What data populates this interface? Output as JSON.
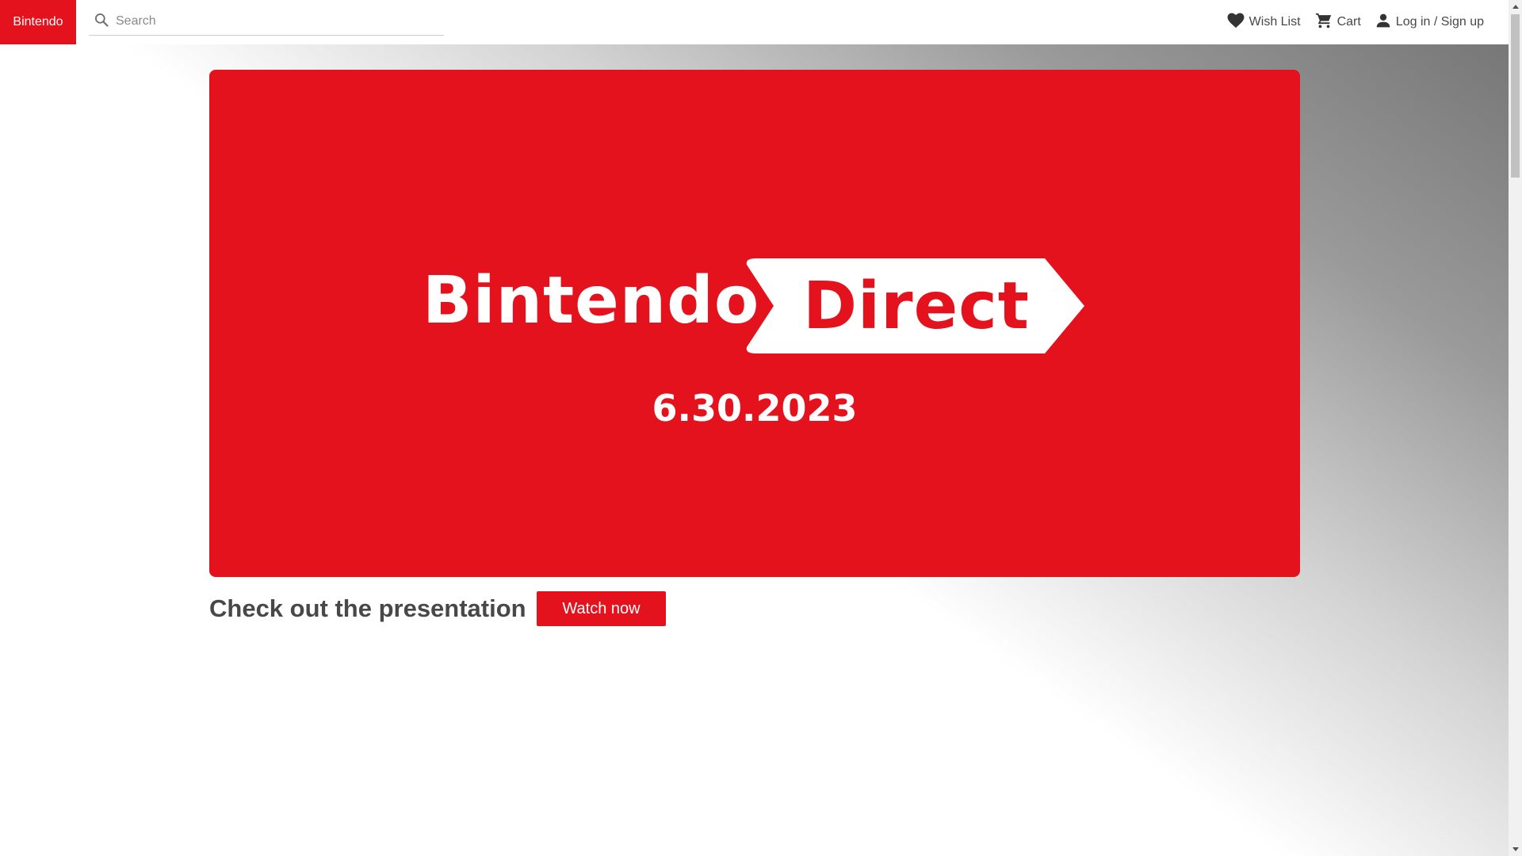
{
  "header": {
    "logo_text": "Bintendo",
    "search": {
      "placeholder": "Search",
      "value": ""
    },
    "nav": {
      "wishlist_label": "Wish List",
      "cart_label": "Cart",
      "login_label": "Log in / Sign up"
    }
  },
  "hero": {
    "title_word": "Bintendo",
    "title_tag": "Direct",
    "date": "6.30.2023"
  },
  "cta": {
    "title": "Check out the presentation",
    "button_label": "Watch now"
  },
  "colors": {
    "brand_red": "#e4121c",
    "text_gray": "#484848"
  },
  "icons": {
    "search": "search-icon",
    "wishlist": "heart-icon",
    "cart": "cart-icon",
    "account": "user-icon"
  }
}
